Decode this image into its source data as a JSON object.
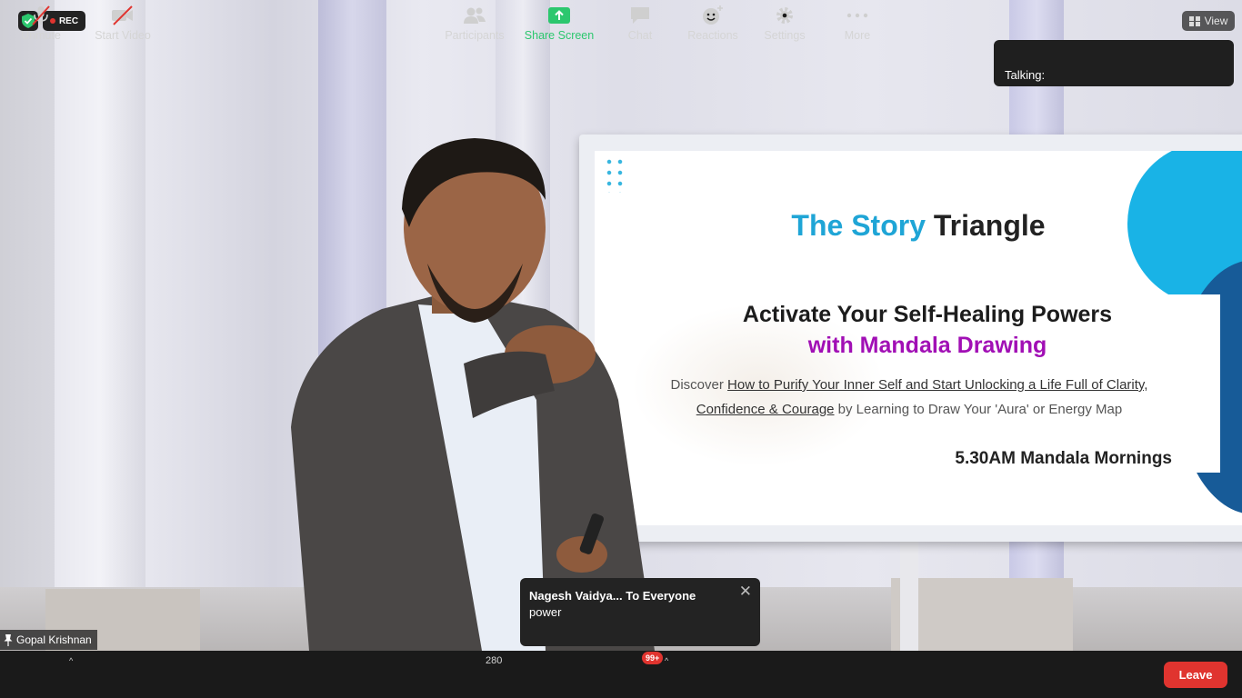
{
  "status": {
    "rec_label": "REC"
  },
  "view": {
    "label": "View"
  },
  "talking": {
    "label": "Talking:"
  },
  "slide": {
    "title_accent": "The Story",
    "title_rest": "Triangle",
    "headline_1": "Activate Your Self-Healing Powers",
    "headline_2": "with Mandala Drawing",
    "desc_prefix": "Discover",
    "desc_link_1": "How to Purify Your Inner Self and Start Unlocking a Life Full of Clarity,",
    "desc_link_2": "Confidence & Courage",
    "desc_suffix": "by Learning to Draw Your 'Aura' or Energy Map",
    "footer": "5.30AM Mandala Mornings"
  },
  "speaker": {
    "name": "Gopal Krishnan"
  },
  "chat_popup": {
    "from": "Nagesh Vaidya... To Everyone",
    "message": "power",
    "close_glyph": "✕"
  },
  "toolbar": {
    "unmute": "Unmute",
    "start_video": "Start Video",
    "participants": "Participants",
    "participants_count": "280",
    "share_screen": "Share Screen",
    "chat": "Chat",
    "chat_badge": "99+",
    "reactions": "Reactions",
    "settings": "Settings",
    "more": "More",
    "leave": "Leave"
  },
  "colors": {
    "accent_blue": "#1fa5d6",
    "accent_purple": "#a10fb5",
    "leave_red": "#e0342f",
    "share_green": "#2cc76e"
  },
  "icons": {
    "shield": "shield-check-icon",
    "rec_dot": "record-dot-icon",
    "view": "grid-view-icon",
    "pin": "pin-icon",
    "mic": "microphone-muted-icon",
    "video": "video-off-icon",
    "participants": "people-icon",
    "share": "share-screen-icon",
    "chat": "chat-bubble-icon",
    "reactions": "smiley-plus-icon",
    "settings": "gear-icon",
    "more": "ellipsis-icon"
  }
}
